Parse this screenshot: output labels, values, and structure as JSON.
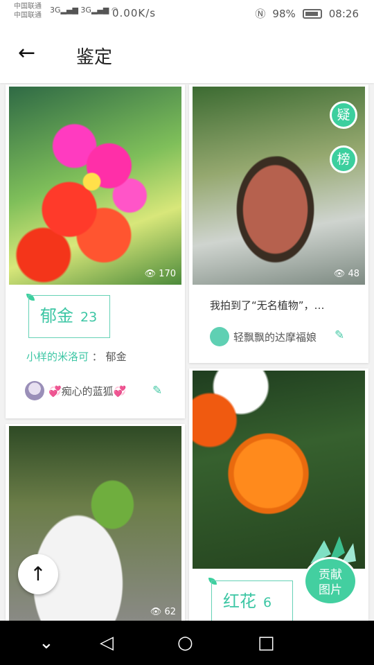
{
  "status_bar": {
    "carrier1": "中国联通",
    "carrier2": "中国联通",
    "signal1": "3G",
    "signal2": "3G",
    "net_speed": "0.00K/s",
    "battery": "98%",
    "time": "08:26"
  },
  "header": {
    "title": "鉴定"
  },
  "cards": {
    "c1": {
      "views": "170",
      "tag_name": "郁金",
      "tag_count": "23",
      "answer_user": "小样的米洛可",
      "answer_sep": "：",
      "answer_text": "郁金",
      "author": "💞痴心的蓝狐💞"
    },
    "c2": {
      "views": "48",
      "description": "我拍到了“无名植物”，…",
      "author": "轻飘飘的达摩福娘",
      "badge_doubt": "疑",
      "badge_rank": "榜"
    },
    "c3": {
      "views": "62"
    },
    "c4": {
      "tag_name": "红花",
      "tag_count": "6"
    }
  },
  "actions": {
    "contribute": "贡献图片",
    "back_to_top_icon": "arrow-up-icon"
  },
  "colors": {
    "accent": "#3ccf9e",
    "tag_text": "#3cc6a4",
    "navbar": "#000000"
  }
}
